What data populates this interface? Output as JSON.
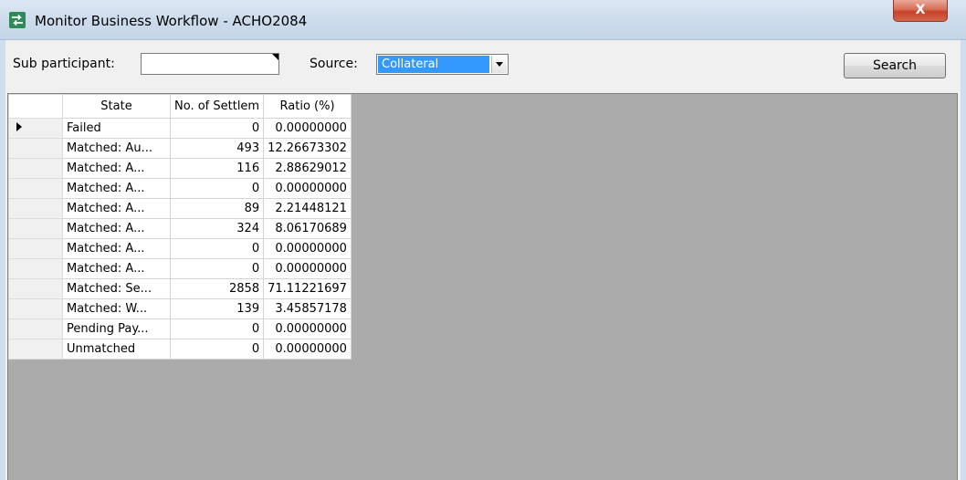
{
  "window": {
    "title": "Monitor Business Workflow - ACHO2084",
    "close_label": "X",
    "icon": "sync-arrows-icon"
  },
  "toolbar": {
    "sub_participant_label": "Sub participant:",
    "sub_participant_value": "",
    "source_label": "Source:",
    "source_value": "Collateral",
    "search_label": "Search"
  },
  "grid": {
    "columns": [
      "State",
      "No. of Settlem",
      "Ratio (%)"
    ],
    "rows": [
      {
        "state": "Failed",
        "count": "0",
        "ratio": "0.00000000"
      },
      {
        "state": "Matched: Au...",
        "count": "493",
        "ratio": "12.26673302"
      },
      {
        "state": "Matched: A...",
        "count": "116",
        "ratio": "2.88629012"
      },
      {
        "state": "Matched: A...",
        "count": "0",
        "ratio": "0.00000000"
      },
      {
        "state": "Matched: A...",
        "count": "89",
        "ratio": "2.21448121"
      },
      {
        "state": "Matched: A...",
        "count": "324",
        "ratio": "8.06170689"
      },
      {
        "state": "Matched: A...",
        "count": "0",
        "ratio": "0.00000000"
      },
      {
        "state": "Matched: A...",
        "count": "0",
        "ratio": "0.00000000"
      },
      {
        "state": "Matched: Se...",
        "count": "2858",
        "ratio": "71.11221697"
      },
      {
        "state": "Matched: W...",
        "count": "139",
        "ratio": "3.45857178"
      },
      {
        "state": "Pending Pay...",
        "count": "0",
        "ratio": "0.00000000"
      },
      {
        "state": "Unmatched",
        "count": "0",
        "ratio": "0.00000000"
      }
    ],
    "current_row_index": 0
  },
  "colors": {
    "selection": "#3399ff",
    "grid_background": "#ababab",
    "close_button": "#c7432a"
  }
}
